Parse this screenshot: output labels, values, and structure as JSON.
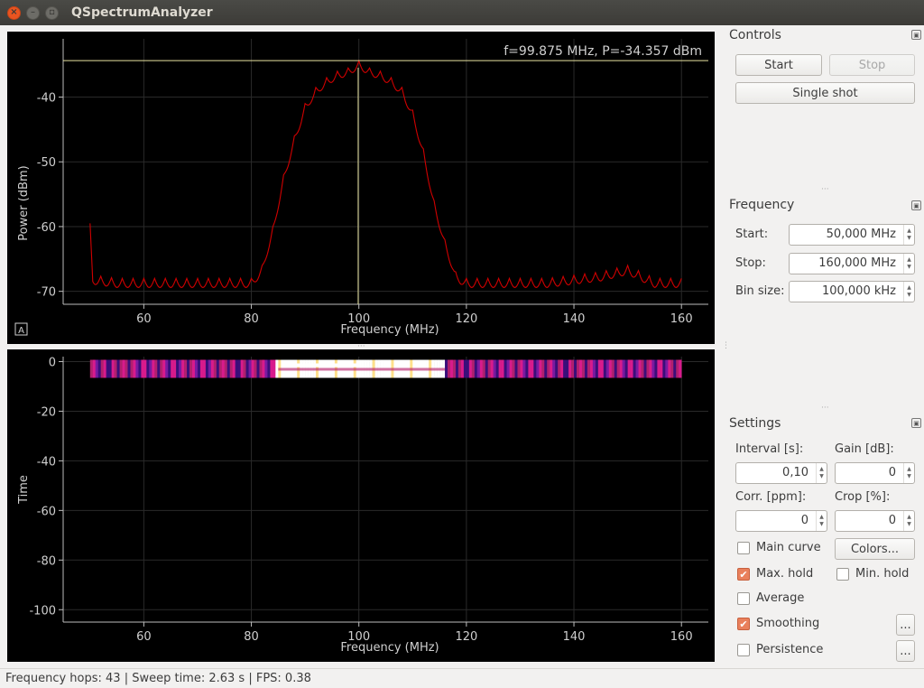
{
  "window": {
    "title": "QSpectrumAnalyzer"
  },
  "spectrum": {
    "readout": "f=99.875 MHz, P=-34.357 dBm",
    "auto_label": "A",
    "xlabel": "Frequency (MHz)",
    "ylabel": "Power (dBm)",
    "xticks": [
      "60",
      "80",
      "100",
      "120",
      "140",
      "160"
    ],
    "yticks": [
      "-40",
      "-50",
      "-60",
      "-70"
    ]
  },
  "waterfall": {
    "xlabel": "Frequency (MHz)",
    "ylabel": "Time",
    "xticks": [
      "60",
      "80",
      "100",
      "120",
      "140",
      "160"
    ],
    "yticks": [
      "0",
      "-20",
      "-40",
      "-60",
      "-80",
      "-100"
    ]
  },
  "chart_data": [
    {
      "type": "line",
      "xlabel": "Frequency (MHz)",
      "ylabel": "Power (dBm)",
      "xlim": [
        45,
        165
      ],
      "ylim": [
        -72,
        -31
      ],
      "grid": true,
      "x": [
        50,
        50.5,
        55,
        60,
        65,
        70,
        75,
        80,
        82,
        84,
        86,
        88,
        90,
        92,
        94,
        96,
        98,
        100,
        102,
        104,
        106,
        108,
        110,
        112,
        114,
        116,
        118,
        120,
        125,
        130,
        135,
        140,
        145,
        150,
        155,
        160
      ],
      "y": [
        -59.5,
        -67.5,
        -68,
        -68,
        -68,
        -68,
        -68,
        -68,
        -66,
        -60,
        -52,
        -46,
        -41,
        -38.5,
        -37,
        -36,
        -35.5,
        -34.4,
        -35.5,
        -36,
        -37,
        -38.5,
        -42,
        -48,
        -56,
        -62,
        -67,
        -68,
        -68,
        -68,
        -68,
        -67.5,
        -67,
        -66,
        -68,
        -68
      ],
      "cursor": {
        "x": 99.875,
        "y": -34.357
      }
    },
    {
      "type": "heatmap",
      "xlabel": "Frequency (MHz)",
      "ylabel": "Time",
      "xlim": [
        45,
        165
      ],
      "ylim": [
        -105,
        2
      ],
      "grid": true,
      "rows": 1,
      "x_start": 50,
      "x_stop": 160
    }
  ],
  "dock": {
    "controls_title": "Controls",
    "start_label": "Start",
    "stop_label": "Stop",
    "single_shot_label": "Single shot",
    "frequency_title": "Frequency",
    "start_freq_label": "Start:",
    "start_freq_value": "50,000 MHz",
    "stop_freq_label": "Stop:",
    "stop_freq_value": "160,000 MHz",
    "bin_size_label": "Bin size:",
    "bin_size_value": "100,000 kHz",
    "settings_title": "Settings",
    "interval_label": "Interval [s]:",
    "interval_value": "0,10",
    "gain_label": "Gain [dB]:",
    "gain_value": "0",
    "corr_label": "Corr. [ppm]:",
    "corr_value": "0",
    "crop_label": "Crop [%]:",
    "crop_value": "0",
    "main_curve_label": "Main curve",
    "colors_label": "Colors...",
    "max_hold_label": "Max. hold",
    "min_hold_label": "Min. hold",
    "average_label": "Average",
    "smoothing_label": "Smoothing",
    "persistence_label": "Persistence",
    "more_label": "...",
    "check_mark": "✔",
    "main_curve_checked": false,
    "max_hold_checked": true,
    "min_hold_checked": false,
    "average_checked": false,
    "smoothing_checked": true,
    "persistence_checked": false
  },
  "status": {
    "text": "Frequency hops: 43 | Sweep time: 2.63 s | FPS: 0.38"
  },
  "colors": {
    "curve": "#d00000",
    "cursor": "#e8e2a0",
    "accent": "#e95420",
    "check": "#e9805c"
  }
}
